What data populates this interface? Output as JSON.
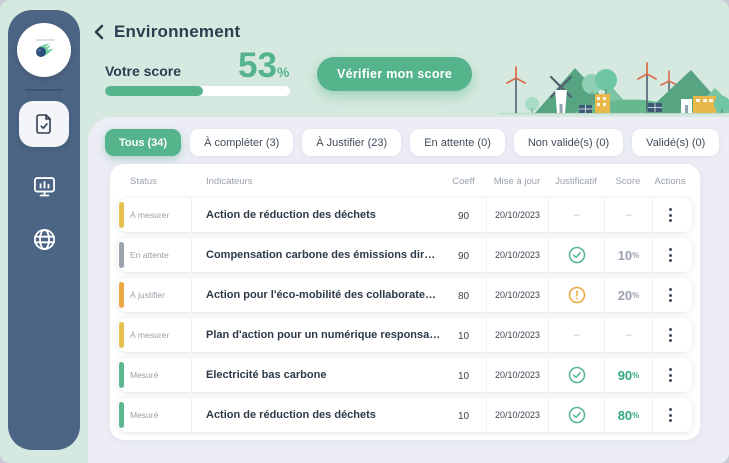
{
  "header": {
    "title": "Environnement"
  },
  "score": {
    "label": "Votre score",
    "value": "53",
    "unit": "%",
    "progress_percent": 53,
    "verify_button": "Vérifier mon score"
  },
  "sidebar": {
    "icons": [
      "comet-logo",
      "document-check",
      "monitor-chart",
      "globe"
    ]
  },
  "tabs": [
    {
      "label": "Tous (34)",
      "active": true
    },
    {
      "label": "À compléter (3)",
      "active": false
    },
    {
      "label": "À Justifier (23)",
      "active": false
    },
    {
      "label": "En attente (0)",
      "active": false
    },
    {
      "label": "Non validé(s) (0)",
      "active": false
    },
    {
      "label": "Validé(s) (0)",
      "active": false
    }
  ],
  "table": {
    "columns": {
      "status": "Status",
      "indicator": "Indicateurs",
      "coeff": "Coeff",
      "updated": "Mise à jour",
      "justificatif": "Justificatif",
      "score": "Score",
      "actions": "Actions"
    },
    "rows": [
      {
        "status": "À mesurer",
        "status_color": "#e5c04d",
        "indicator": "Action de réduction des déchets",
        "coeff": "90",
        "updated": "20/10/2023",
        "justificatif_icon": "none",
        "justificatif_text": "–",
        "score": "–",
        "score_unit": ""
      },
      {
        "status": "En attente",
        "status_color": "#9aa3ad",
        "indicator": "Compensation carbone des émissions directes",
        "coeff": "90",
        "updated": "20/10/2023",
        "justificatif_icon": "check",
        "justificatif_text": "",
        "score": "10",
        "score_unit": "%"
      },
      {
        "status": "À justifier",
        "status_color": "#eba741",
        "indicator": "Action pour l'éco-mobilité des collaborateurs",
        "coeff": "80",
        "updated": "20/10/2023",
        "justificatif_icon": "alert",
        "justificatif_text": "",
        "score": "20",
        "score_unit": "%"
      },
      {
        "status": "À mesurer",
        "status_color": "#e5c04d",
        "indicator": "Plan d'action pour un numérique responsable",
        "coeff": "10",
        "updated": "20/10/2023",
        "justificatif_icon": "none",
        "justificatif_text": "–",
        "score": "–",
        "score_unit": ""
      },
      {
        "status": "Mesuré",
        "status_color": "#5cb88f",
        "indicator": "Electricité bas carbone",
        "coeff": "10",
        "updated": "20/10/2023",
        "justificatif_icon": "check",
        "justificatif_text": "",
        "score": "90",
        "score_unit": "%"
      },
      {
        "status": "Mesuré",
        "status_color": "#5cb88f",
        "indicator": "Action de réduction des déchets",
        "coeff": "10",
        "updated": "20/10/2023",
        "justificatif_icon": "check",
        "justificatif_text": "",
        "score": "80",
        "score_unit": "%"
      }
    ]
  },
  "colors": {
    "accent_green": "#55b48c",
    "sidebar_blue": "#4d6585",
    "mint_background": "#d6e9e0",
    "panel_lavender": "#ecedf5",
    "status_yellow": "#e5c04d",
    "status_grey": "#9aa3ad",
    "status_orange": "#eba741",
    "status_green": "#5cb88f",
    "warning_orange": "#e9a93d",
    "score_high_green": "#33a77d",
    "text_dark": "#2e3e50"
  }
}
